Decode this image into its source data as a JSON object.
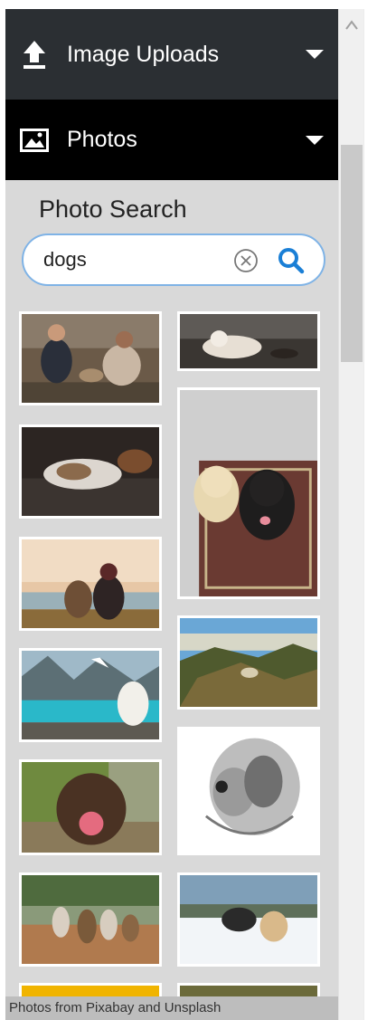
{
  "sections": {
    "uploads": {
      "label": "Image Uploads",
      "icon": "upload-icon"
    },
    "photos": {
      "label": "Photos",
      "icon": "image-icon"
    }
  },
  "search": {
    "title": "Photo Search",
    "query": "dogs",
    "placeholder": "",
    "clear_icon": "clear-icon",
    "search_icon": "search-icon"
  },
  "results": [
    {
      "subject": "people-with-dog"
    },
    {
      "subject": "white-dog-lying"
    },
    {
      "subject": "husky-on-couch"
    },
    {
      "subject": "two-dogs-on-rug"
    },
    {
      "subject": "dog-and-person-sunset"
    },
    {
      "subject": "mountain-landscape-dog"
    },
    {
      "subject": "dog-by-lake"
    },
    {
      "subject": "dog-sketch"
    },
    {
      "subject": "dog-licking-nose"
    },
    {
      "subject": "dogs-playing-snow"
    },
    {
      "subject": "dog-walker-group"
    },
    {
      "subject": "yellow-photo"
    },
    {
      "subject": "olive-photo"
    }
  ],
  "footer": {
    "prefix": "Photos from ",
    "source1": "Pixabay",
    "middle": " and ",
    "source2": "Unsplash"
  },
  "colors": {
    "header_uploads": "#2b2f33",
    "header_photos": "#000000",
    "panel_bg": "#d9d9d9",
    "accent_blue": "#1a7fd6"
  }
}
